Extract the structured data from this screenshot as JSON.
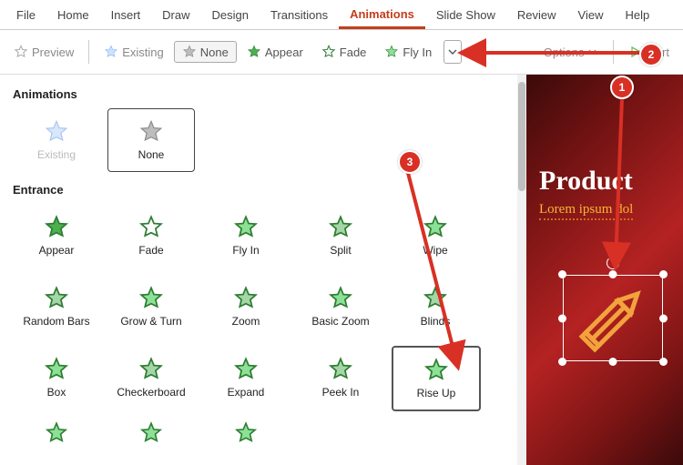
{
  "tabs": [
    "File",
    "Home",
    "Insert",
    "Draw",
    "Design",
    "Transitions",
    "Animations",
    "Slide Show",
    "Review",
    "View",
    "Help"
  ],
  "active_tab_index": 6,
  "toolbar": {
    "preview": "Preview",
    "existing": "Existing",
    "none": "None",
    "appear": "Appear",
    "fade": "Fade",
    "flyin": "Fly In",
    "options": "Options",
    "start": "Start"
  },
  "gallery": {
    "group1": "Animations",
    "group1_items": [
      {
        "label": "Existing",
        "key": "existing"
      },
      {
        "label": "None",
        "key": "none",
        "selected": true
      }
    ],
    "group2": "Entrance",
    "group2_items": [
      {
        "label": "Appear"
      },
      {
        "label": "Fade"
      },
      {
        "label": "Fly In"
      },
      {
        "label": "Split"
      },
      {
        "label": "Wipe"
      },
      {
        "label": "Random Bars"
      },
      {
        "label": "Grow & Turn"
      },
      {
        "label": "Zoom"
      },
      {
        "label": "Basic Zoom"
      },
      {
        "label": "Blinds"
      },
      {
        "label": "Box"
      },
      {
        "label": "Checkerboard"
      },
      {
        "label": "Expand"
      },
      {
        "label": "Peek In"
      },
      {
        "label": "Rise Up",
        "selected": true
      }
    ]
  },
  "slide": {
    "title": "Product",
    "subtitle": "Lorem ipsum dol"
  },
  "callouts": {
    "one": "1",
    "two": "2",
    "three": "3"
  }
}
